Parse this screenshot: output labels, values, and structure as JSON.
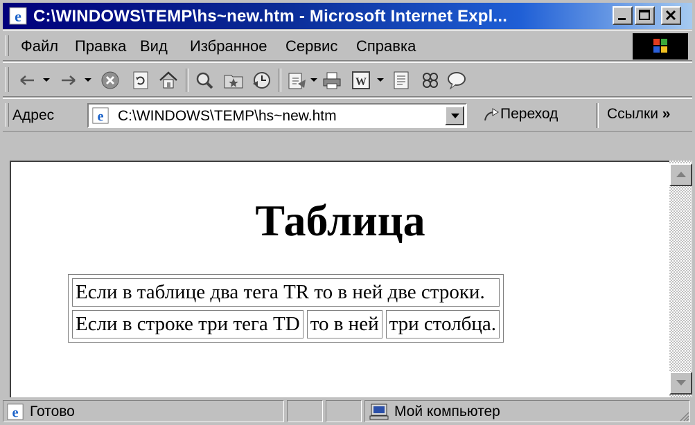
{
  "window": {
    "title": "C:\\WINDOWS\\TEMP\\hs~new.htm - Microsoft Internet Expl..."
  },
  "menu": [
    "Файл",
    "Правка",
    "Вид",
    "Избранное",
    "Сервис",
    "Справка"
  ],
  "address": {
    "label": "Адрес",
    "url": "C:\\WINDOWS\\TEMP\\hs~new.htm",
    "go_label": "Переход",
    "links_label": "Ссылки"
  },
  "content": {
    "heading": "Таблица",
    "table": {
      "row1": "Если в таблице два тега TR то в ней две строки.",
      "row2": [
        "Если в строке три тега TD",
        "то в ней",
        "три столбца."
      ]
    }
  },
  "status": {
    "text": "Готово",
    "zone": "Мой компьютер"
  },
  "colors": {
    "titlebar_start": "#00007b",
    "titlebar_end": "#a6caf0",
    "chrome": "#c0c0c0"
  },
  "icons": [
    "ie-page-icon",
    "minimize-icon",
    "maximize-icon",
    "close-icon",
    "windows-logo-icon",
    "back-icon",
    "forward-icon",
    "stop-icon",
    "refresh-icon",
    "home-icon",
    "search-icon",
    "favorites-icon",
    "history-icon",
    "mail-icon",
    "print-icon",
    "edit-word-icon",
    "discuss-icon",
    "messenger-icon",
    "chat-icon",
    "go-arrow-icon",
    "computer-icon"
  ]
}
